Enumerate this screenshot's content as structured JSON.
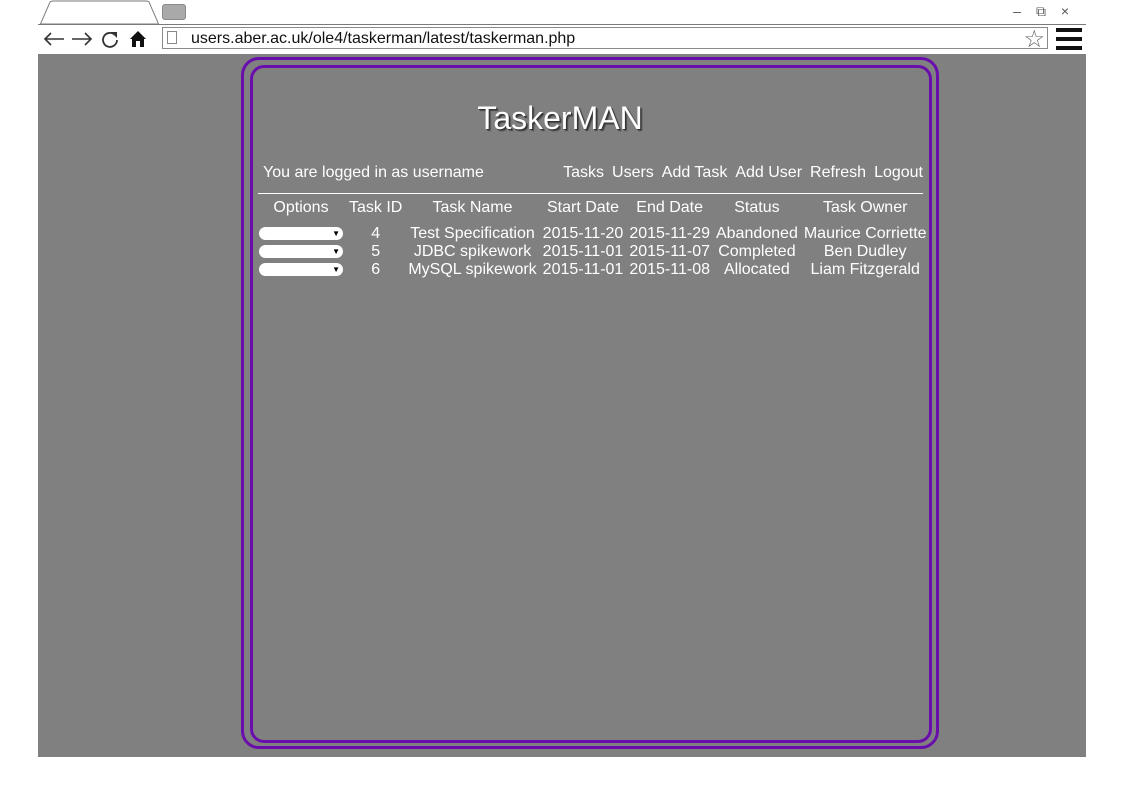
{
  "browser": {
    "url": "users.aber.ac.uk/ole4/taskerman/latest/taskerman.php",
    "window_controls": [
      "–",
      "⧉",
      "×"
    ],
    "icons": {
      "back": "back-arrow-icon",
      "forward": "forward-arrow-icon",
      "reload": "reload-icon",
      "home": "home-icon",
      "page": "page-icon",
      "bookmark": "star-icon",
      "menu": "hamburger-menu-icon"
    },
    "accent_color": "#6a0dad",
    "viewport_bg": "#808080"
  },
  "app": {
    "title": "TaskerMAN",
    "login_text": "You are logged in as username",
    "nav": [
      "Tasks",
      "Users",
      "Add Task",
      "Add User",
      "Refresh",
      "Logout"
    ]
  },
  "table": {
    "headers": [
      "Options",
      "Task ID",
      "Task Name",
      "Start Date",
      "End Date",
      "Status",
      "Task Owner"
    ],
    "rows": [
      {
        "id": "4",
        "name": "Test Specification",
        "start": "2015-11-20",
        "end": "2015-11-29",
        "status": "Abandoned",
        "owner": "Maurice Corriette"
      },
      {
        "id": "5",
        "name": "JDBC spikework",
        "start": "2015-11-01",
        "end": "2015-11-07",
        "status": "Completed",
        "owner": "Ben Dudley"
      },
      {
        "id": "6",
        "name": "MySQL spikework",
        "start": "2015-11-01",
        "end": "2015-11-08",
        "status": "Allocated",
        "owner": "Liam Fitzgerald"
      }
    ]
  }
}
